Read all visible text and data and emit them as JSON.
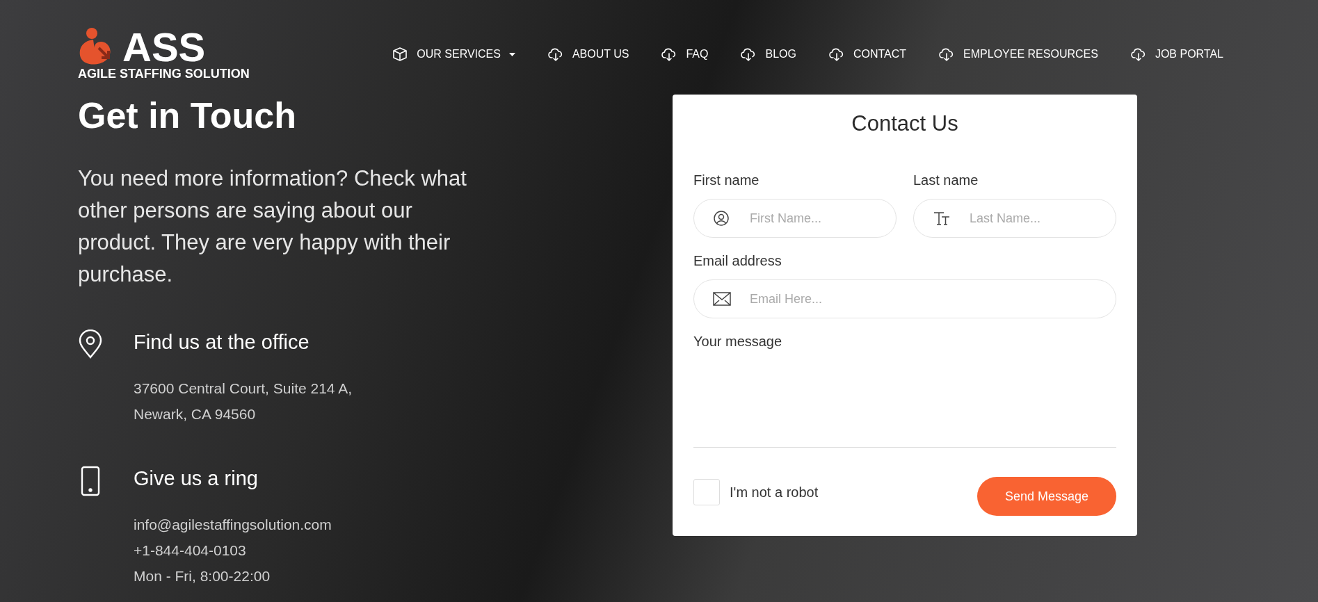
{
  "logo": {
    "mark": "ASS",
    "tagline": "AGILE STAFFING SOLUTION"
  },
  "nav": [
    {
      "label": "OUR SERVICES",
      "kind": "dropdown"
    },
    {
      "label": "ABOUT US",
      "kind": "link"
    },
    {
      "label": "FAQ",
      "kind": "link"
    },
    {
      "label": "BLOG",
      "kind": "link"
    },
    {
      "label": "CONTACT",
      "kind": "link"
    },
    {
      "label": "EMPLOYEE RESOURCES",
      "kind": "link"
    },
    {
      "label": "JOB PORTAL",
      "kind": "link"
    }
  ],
  "heading": "Get in Touch",
  "intro": "You need more information? Check what other persons are saying about our product. They are very happy with their purchase.",
  "contact_info": [
    {
      "kind": "location",
      "title": "Find us at the office",
      "lines": [
        "37600 Central Court, Suite 214 A,",
        "Newark, CA 94560"
      ]
    },
    {
      "kind": "phone",
      "title": "Give us a ring",
      "lines": [
        "info@agilestaffingsolution.com",
        "+1-844-404-0103",
        "Mon - Fri, 8:00-22:00"
      ]
    }
  ],
  "form": {
    "title": "Contact Us",
    "fields": [
      {
        "kind": "person",
        "label": "First name",
        "placeholder": "First Name..."
      },
      {
        "kind": "text",
        "label": "Last name",
        "placeholder": "Last Name..."
      },
      {
        "kind": "email",
        "label": "Email address",
        "placeholder": "Email Here..."
      }
    ],
    "message_label": "Your message",
    "captcha": {
      "label": "I'm not a robot",
      "checked": false
    },
    "submit": "Send Message"
  }
}
